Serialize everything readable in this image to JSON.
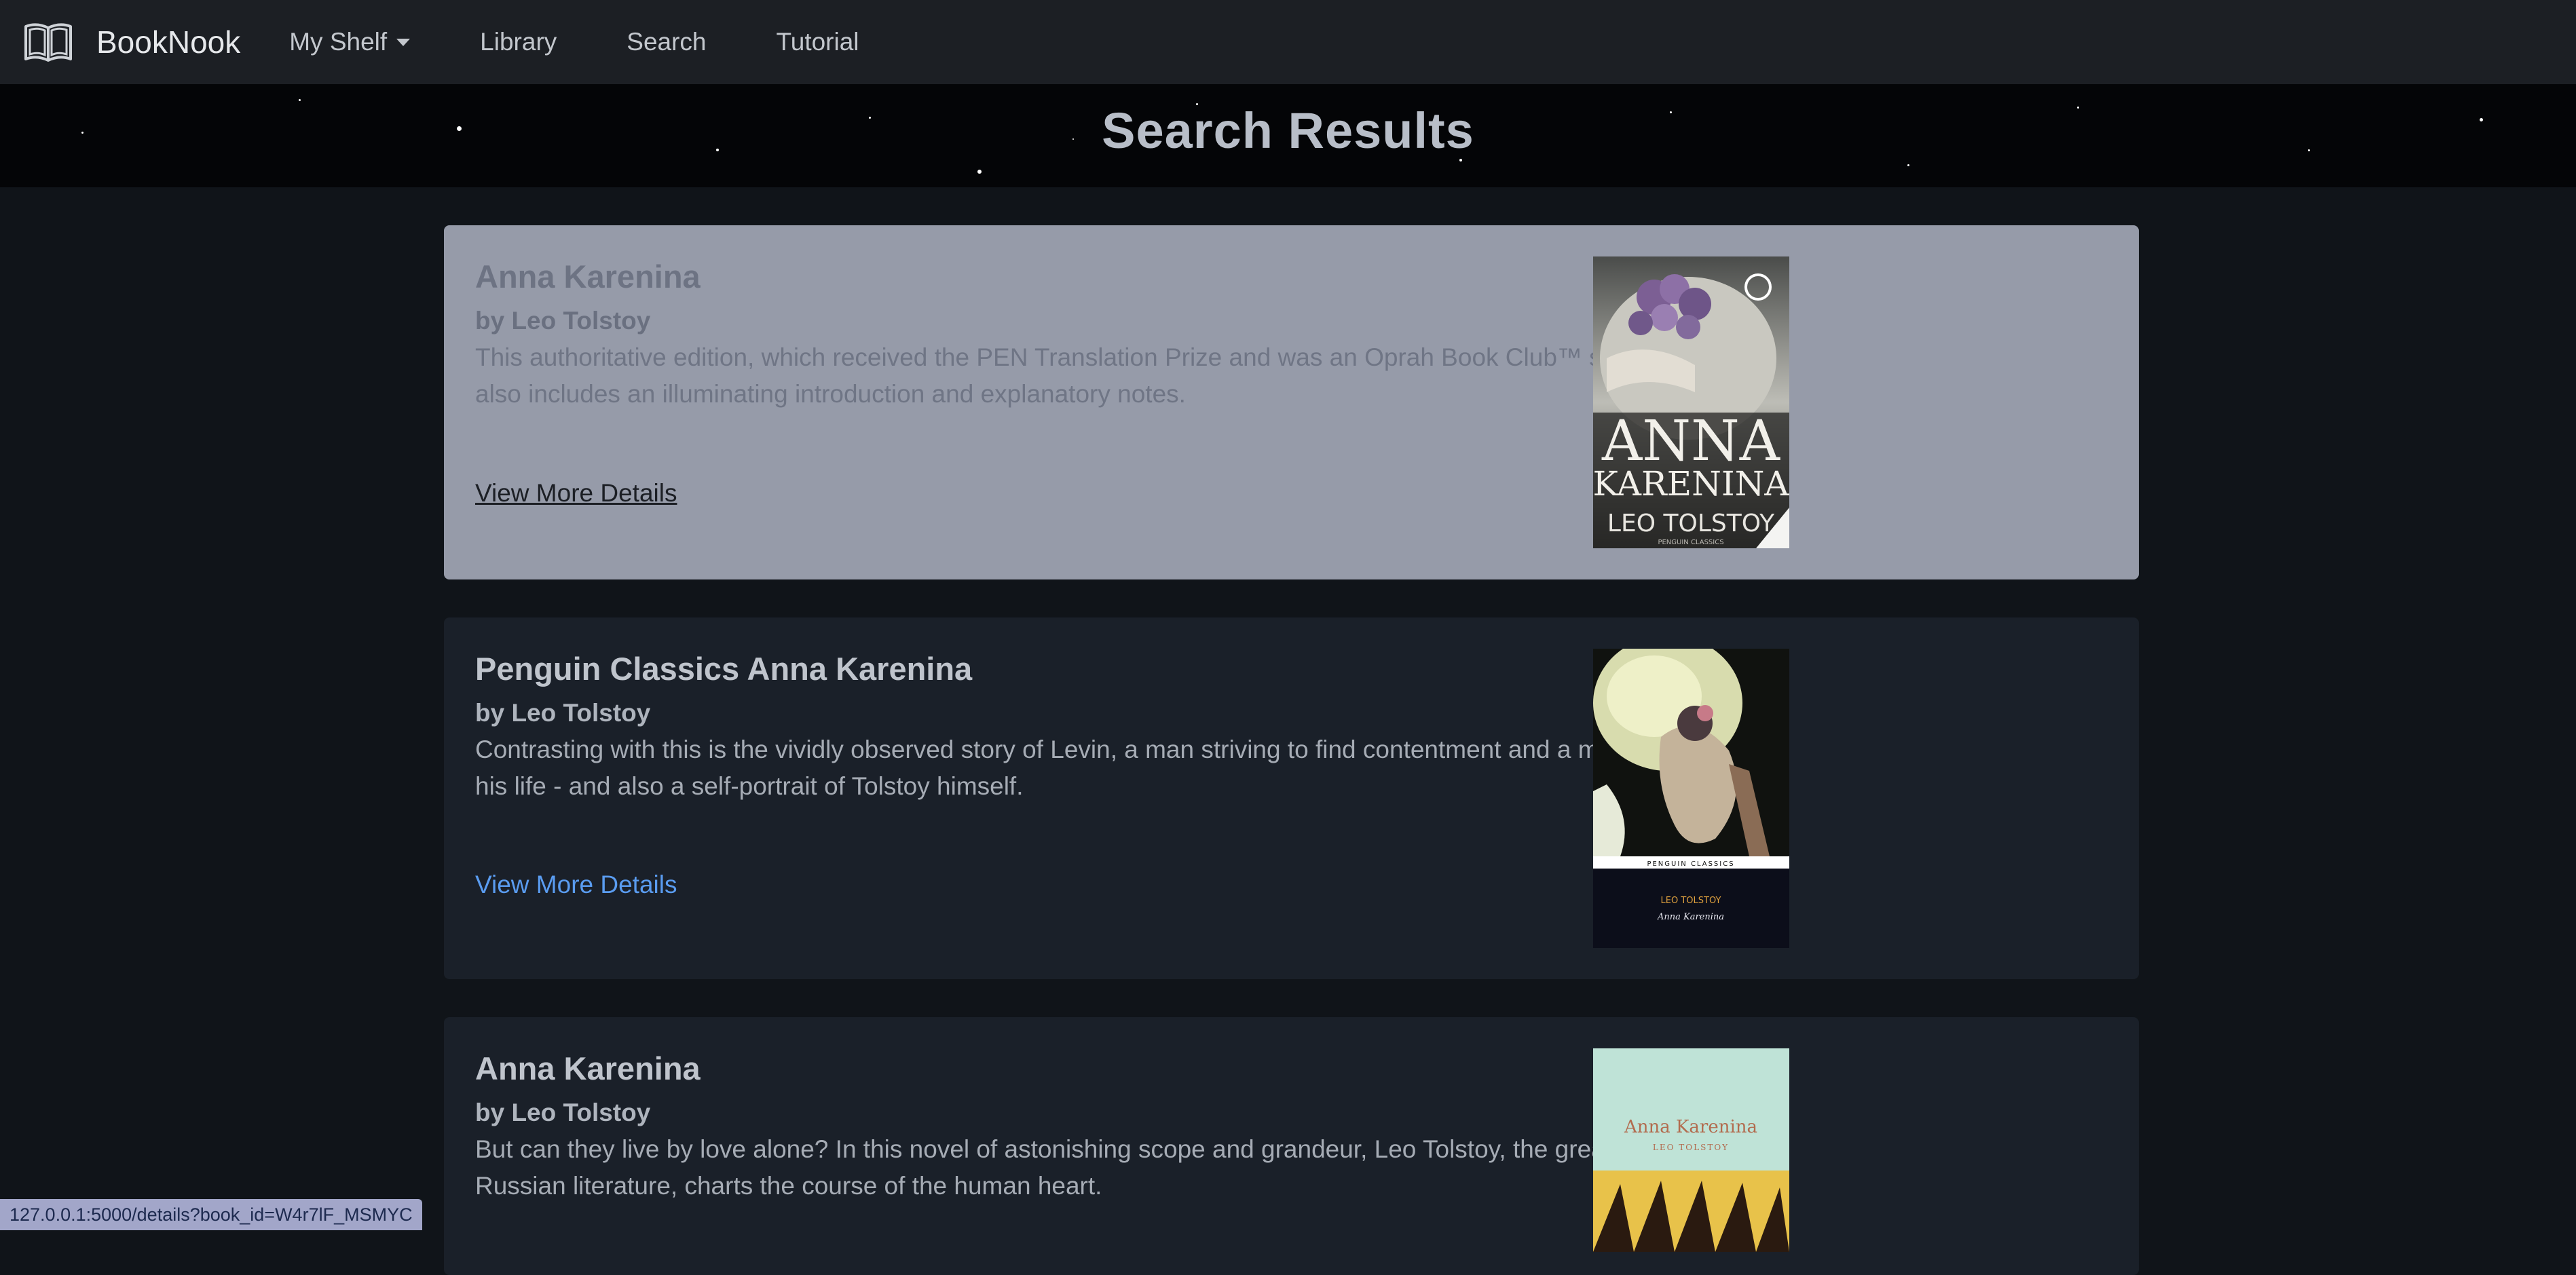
{
  "navbar": {
    "brand": "BookNook",
    "brand_icon": "open-book-icon",
    "items": [
      {
        "label": "My Shelf",
        "has_dropdown": true
      },
      {
        "label": "Library"
      },
      {
        "label": "Search"
      },
      {
        "label": "Tutorial"
      }
    ]
  },
  "hero": {
    "title": "Search Results"
  },
  "results": [
    {
      "title": "Anna Karenina",
      "author": "by Leo Tolstoy",
      "description": "This authoritative edition, which received the PEN Translation Prize and was an Oprah Book Club™ selection, also includes an illuminating introduction and explanatory notes.",
      "link_label": "View More Details",
      "hovered": true,
      "cover": {
        "title_line1": "ANNA",
        "title_line2": "KARENINA",
        "author": "LEO TOLSTOY",
        "publisher": "PENGUIN CLASSICS"
      }
    },
    {
      "title": "Penguin Classics Anna Karenina",
      "author": "by Leo Tolstoy",
      "description": "Contrasting with this is the vividly observed story of Levin, a man striving to find contentment and a meaning to his life - and also a self-portrait of Tolstoy himself.",
      "link_label": "View More Details",
      "hovered": false,
      "cover": {
        "series": "PENGUIN CLASSICS",
        "author": "LEO TOLSTOY",
        "title": "Anna Karenina"
      }
    },
    {
      "title": "Anna Karenina",
      "author": "by Leo Tolstoy",
      "description": "But can they live by love alone? In this novel of astonishing scope and grandeur, Leo Tolstoy, the great master of Russian literature, charts the course of the human heart.",
      "link_label": "View More Details",
      "hovered": false,
      "cover": {
        "title": "Anna Karenina",
        "author": "LEO TOLSTOY"
      }
    }
  ],
  "status_bar": {
    "url": "127.0.0.1:5000/details?book_id=W4r7lF_MSMYC"
  },
  "colors": {
    "background": "#101419",
    "navbar": "#1c1f24",
    "card": "#1a2029",
    "card_hover": "#969ba9",
    "link": "#5a9cf0"
  }
}
